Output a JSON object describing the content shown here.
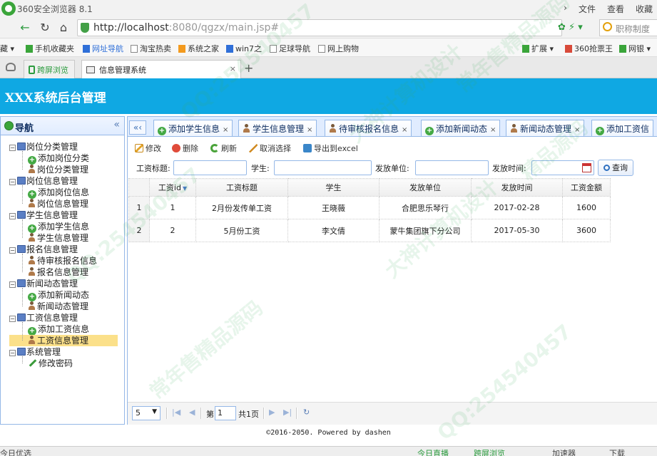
{
  "browser": {
    "title": "360安全浏览器 8.1",
    "menus": [
      "›",
      "文件",
      "查看",
      "收藏"
    ],
    "url_host": "http://localhost",
    "url_rest": ":8080/qgzx/main.jsp#",
    "search_placeholder": "职称制度",
    "favorites": [
      "藏",
      "手机收藏夹",
      "网址导航",
      "淘宝热卖",
      "系统之家",
      "win7之",
      "足球导航",
      "网上购物",
      "扩展",
      "360抢票王",
      "网银"
    ],
    "tabs": {
      "first": "跨屏浏览",
      "active": "信息管理系统"
    },
    "status": {
      "left": "今日优选",
      "live": "今日直播",
      "cross": "跨屏浏览",
      "speed": "加速器",
      "download": "下载"
    }
  },
  "app": {
    "title": "XXX系统后台管理"
  },
  "nav": {
    "title": "导航",
    "groups": [
      {
        "label": "岗位分类管理",
        "items": [
          {
            "label": "添加岗位分类",
            "icon": "add-icon"
          },
          {
            "label": "岗位分类管理",
            "icon": "user-icon"
          }
        ]
      },
      {
        "label": "岗位信息管理",
        "items": [
          {
            "label": "添加岗位信息",
            "icon": "add-icon"
          },
          {
            "label": "岗位信息管理",
            "icon": "user-icon"
          }
        ]
      },
      {
        "label": "学生信息管理",
        "items": [
          {
            "label": "添加学生信息",
            "icon": "add-icon"
          },
          {
            "label": "学生信息管理",
            "icon": "user-icon"
          }
        ]
      },
      {
        "label": "报名信息管理",
        "items": [
          {
            "label": "待审核报名信息",
            "icon": "user-icon"
          },
          {
            "label": "报名信息管理",
            "icon": "user-icon"
          }
        ]
      },
      {
        "label": "新闻动态管理",
        "items": [
          {
            "label": "添加新闻动态",
            "icon": "add-icon"
          },
          {
            "label": "新闻动态管理",
            "icon": "user-icon"
          }
        ]
      },
      {
        "label": "工资信息管理",
        "items": [
          {
            "label": "添加工资信息",
            "icon": "add-icon"
          },
          {
            "label": "工资信息管理",
            "icon": "user-icon",
            "selected": true
          }
        ]
      },
      {
        "label": "系统管理",
        "items": [
          {
            "label": "修改密码",
            "icon": "pen-icon"
          }
        ]
      }
    ]
  },
  "tabs": [
    {
      "label": "添加学生信息",
      "icon": "add-icon"
    },
    {
      "label": "学生信息管理",
      "icon": "user-icon"
    },
    {
      "label": "待审核报名信息",
      "icon": "user-icon"
    },
    {
      "label": "添加新闻动态",
      "icon": "add-icon"
    },
    {
      "label": "新闻动态管理",
      "icon": "user-icon"
    },
    {
      "label": "添加工资信",
      "icon": "add-icon"
    }
  ],
  "toolbar": {
    "edit": "修改",
    "delete": "删除",
    "refresh": "刷新",
    "cancel_select": "取消选择",
    "export": "导出到excel"
  },
  "search": {
    "title_label": "工资标题:",
    "student_label": "学生:",
    "unit_label": "发放单位:",
    "time_label": "发放时间:",
    "query": "查询"
  },
  "table": {
    "columns": [
      "工资id",
      "工资标题",
      "学生",
      "发放单位",
      "发放时间",
      "工资金额"
    ],
    "rows": [
      {
        "n": "1",
        "id": "1",
        "title": "2月份发传单工资",
        "student": "王晓薇",
        "unit": "合肥思乐琴行",
        "time": "2017-02-28",
        "amount": "1600"
      },
      {
        "n": "2",
        "id": "2",
        "title": "5月份工资",
        "student": "李文倩",
        "unit": "蒙牛集团旗下分公司",
        "time": "2017-05-30",
        "amount": "3600"
      }
    ]
  },
  "pager": {
    "page_size": "5",
    "page_label": "第",
    "page_num": "1",
    "total": "共1页"
  },
  "footer": "©2016-2050. Powered by dashen",
  "watermarks": [
    "QQ:254540457",
    "大神计算机设计",
    "常年售精品源码",
    "QQ:254540457",
    "大神计算机设计",
    "常年售精品源码",
    "QQ:254540457",
    "精品源码"
  ]
}
